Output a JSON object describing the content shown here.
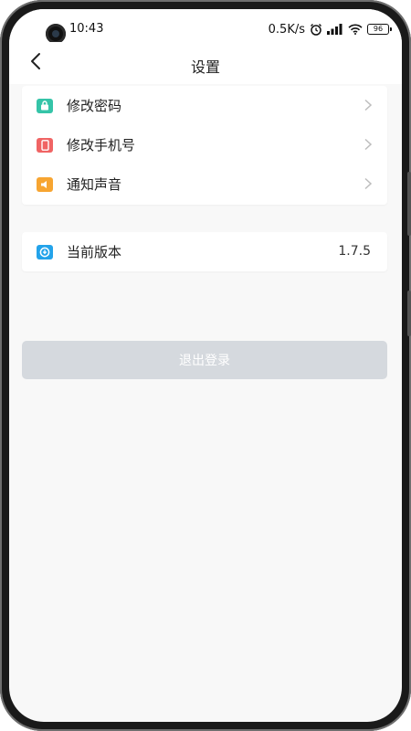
{
  "status_bar": {
    "time": "10:43",
    "network_speed": "0.5K/s",
    "battery_level": "96",
    "icons": [
      "alarm-icon",
      "signal-icon",
      "wifi-icon",
      "battery-icon"
    ]
  },
  "header": {
    "title": "设置",
    "back_icon": "back-chevron-icon"
  },
  "settings_group_1": [
    {
      "label": "修改密码",
      "icon": "lock-icon",
      "icon_color": "#35c4a8"
    },
    {
      "label": "修改手机号",
      "icon": "phone-icon",
      "icon_color": "#f06464"
    },
    {
      "label": "通知声音",
      "icon": "speaker-icon",
      "icon_color": "#f7a531"
    }
  ],
  "settings_group_2": [
    {
      "label": "当前版本",
      "value": "1.7.5",
      "icon": "version-icon",
      "icon_color": "#23a3ea"
    }
  ],
  "logout": {
    "label": "退出登录",
    "background": "#d5d9de"
  },
  "colors": {
    "page_background": "#f8f8f8",
    "card_background": "#ffffff",
    "chevron": "#bdbdbd"
  }
}
